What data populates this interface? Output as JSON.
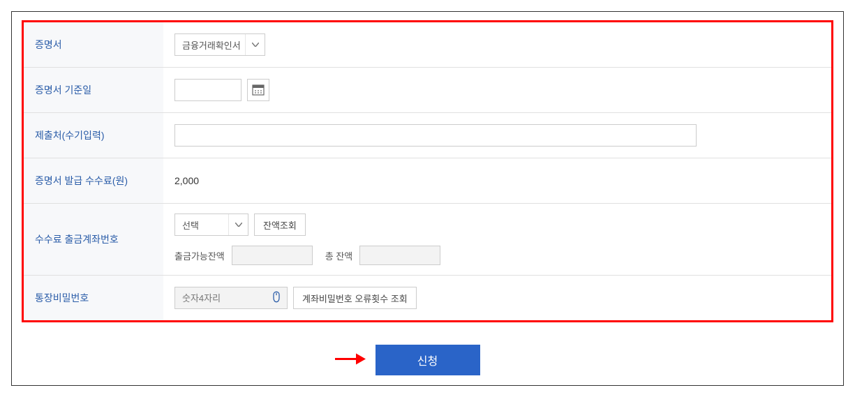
{
  "form": {
    "rows": {
      "certificate": {
        "label": "증명서",
        "selected": "금융거래확인서"
      },
      "baseDate": {
        "label": "증명서 기준일",
        "value": ""
      },
      "submitTo": {
        "label": "제출처(수기입력)",
        "value": ""
      },
      "fee": {
        "label": "증명서 발급 수수료(원)",
        "value": "2,000"
      },
      "withdrawAccount": {
        "label": "수수료 출금계좌번호",
        "selected": "선택",
        "balanceCheckBtn": "잔액조회",
        "availableLabel": "출금가능잔액",
        "availableValue": "",
        "totalLabel": "총 잔액",
        "totalValue": ""
      },
      "password": {
        "label": "통장비밀번호",
        "placeholder": "숫자4자리",
        "errorCheckBtn": "계좌비밀번호 오류횟수 조회"
      }
    }
  },
  "submit": {
    "label": "신청"
  }
}
